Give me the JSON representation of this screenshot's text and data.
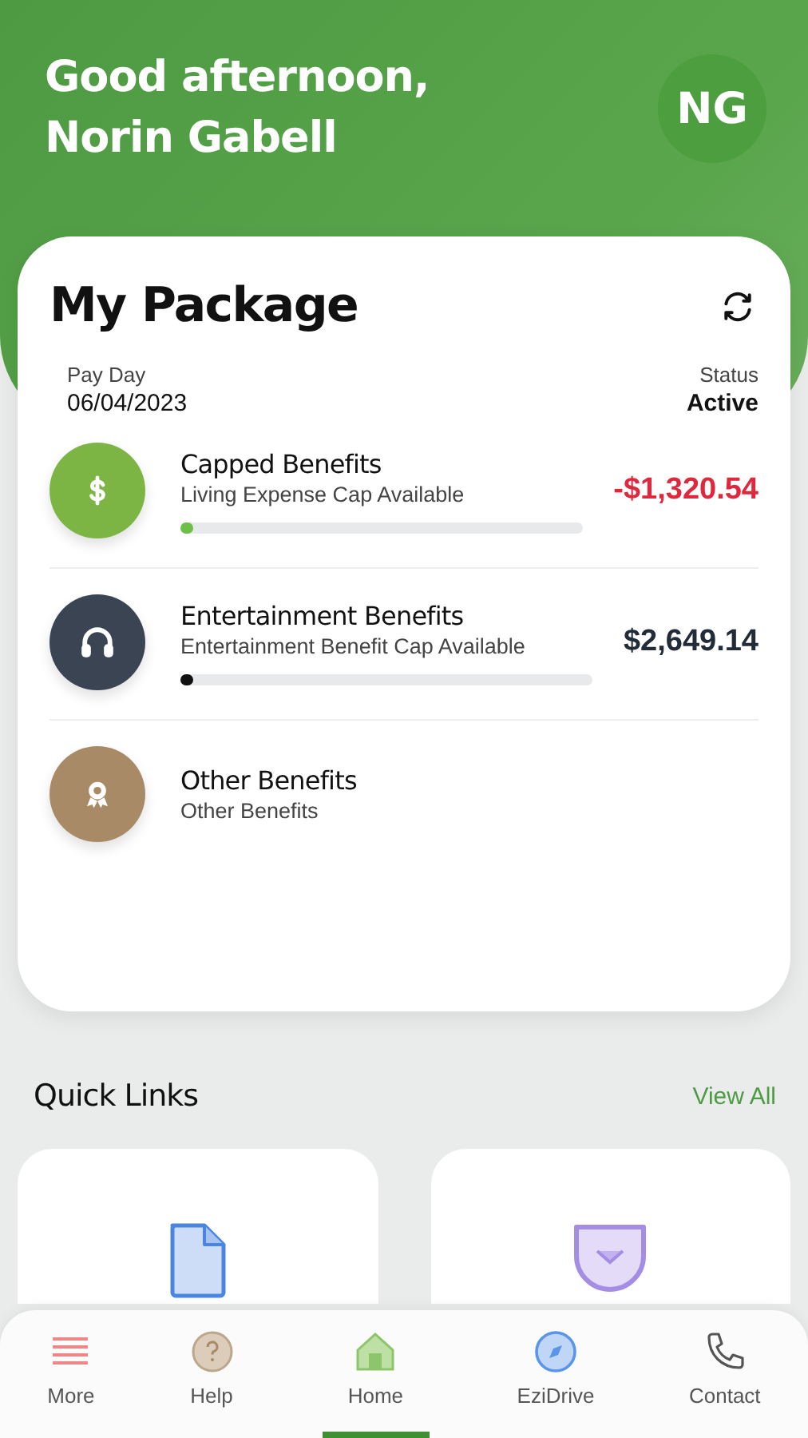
{
  "header": {
    "greeting": "Good afternoon,",
    "name": "Norin Gabell",
    "avatar_initials": "NG"
  },
  "package": {
    "title": "My Package",
    "pay_day_label": "Pay Day",
    "pay_day": "06/04/2023",
    "status_label": "Status",
    "status": "Active",
    "benefits": [
      {
        "kind": "capped",
        "color": "#7cb544",
        "title": "Capped Benefits",
        "subtitle": "Living Expense Cap Available",
        "amount": "-$1,320.54",
        "negative": true,
        "level": 0.02
      },
      {
        "kind": "entertainment",
        "color": "#3a4452",
        "title": "Entertainment Benefits",
        "subtitle": "Entertainment Benefit Cap Available",
        "amount": "$2,649.14",
        "negative": false,
        "level": 0.02
      },
      {
        "kind": "other",
        "color": "#a88b66",
        "title": "Other Benefits",
        "subtitle": "Other Benefits"
      }
    ]
  },
  "quick_links": {
    "title": "Quick Links",
    "view_all": "View All",
    "cards": [
      {
        "kind": "document"
      },
      {
        "kind": "pocket"
      }
    ]
  },
  "nav": [
    {
      "kind": "more",
      "label": "More",
      "selected": false
    },
    {
      "kind": "help",
      "label": "Help",
      "selected": false
    },
    {
      "kind": "home",
      "label": "Home",
      "selected": true
    },
    {
      "kind": "drive",
      "label": "EziDrive",
      "selected": false
    },
    {
      "kind": "contact",
      "label": "Contact",
      "selected": false
    }
  ]
}
